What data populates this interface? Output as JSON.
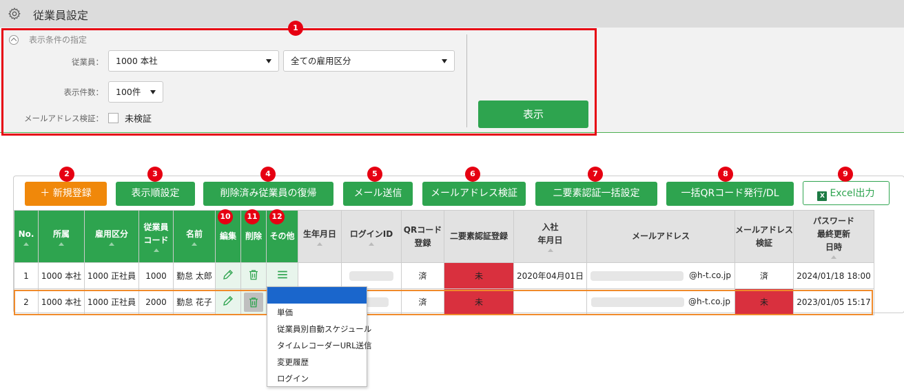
{
  "header": {
    "title": "従業員設定",
    "icon": "gear-icon"
  },
  "filter": {
    "section_title": "表示条件の指定",
    "employee_label": "従業員：",
    "employee_value": "1000 本社",
    "employment_value": "全ての雇用区分",
    "count_label": "表示件数：",
    "count_value": "100件",
    "email_label": "メールアドレス検証：",
    "email_checkbox_label": "未検証",
    "show_button": "表示"
  },
  "badges": [
    "1",
    "2",
    "3",
    "4",
    "5",
    "6",
    "7",
    "8",
    "9",
    "10",
    "11",
    "12"
  ],
  "toolbar": {
    "new": "＋ 新規登録",
    "order": "表示順設定",
    "restore": "削除済み従業員の復帰",
    "mail": "メール送信",
    "verify": "メールアドレス検証",
    "twofactor": "二要素認証一括設定",
    "qr": "一括QRコード発行/DL",
    "excel": "Excel出力"
  },
  "columns": {
    "no": "No.",
    "dept": "所属",
    "type": "雇用区分",
    "code1": "従業員",
    "code2": "コード",
    "name": "名前",
    "edit": "編集",
    "delete": "削除",
    "other": "その他",
    "birth": "生年月日",
    "login": "ログインID",
    "qr1": "QRコード",
    "qr2": "登録",
    "twofa": "二要素認証登録",
    "join1": "入社",
    "join2": "年月日",
    "email": "メールアドレス",
    "ev1": "メールアドレス",
    "ev2": "検証",
    "pw1": "パスワード",
    "pw2": "最終更新",
    "pw3": "日時"
  },
  "rows": [
    {
      "no": "1",
      "dept": "1000 本社",
      "type": "1000 正社員",
      "code": "1000",
      "name": "勤怠 太郎",
      "qr": "済",
      "twofa": "未",
      "join": "2020年04月01日",
      "email": "@h-t.co.jp",
      "verified": "済",
      "pw": "2024/01/18 18:00"
    },
    {
      "no": "2",
      "dept": "1000 本社",
      "type": "1000 正社員",
      "code": "2000",
      "name": "勤怠 花子",
      "qr": "済",
      "twofa": "未",
      "join": "",
      "email": "@h-t.co.jp",
      "verified": "未",
      "pw": "2023/01/05 15:17"
    }
  ],
  "menu": [
    "単価",
    "従業員別自動スケジュール",
    "タイムレコーダーURL送信",
    "変更履歴",
    "ログイン"
  ],
  "colors": {
    "green": "#2ea44f",
    "orange": "#f0880a",
    "red": "#e60012",
    "cell_red": "#d9303e",
    "menu_blue": "#1a66cc"
  }
}
